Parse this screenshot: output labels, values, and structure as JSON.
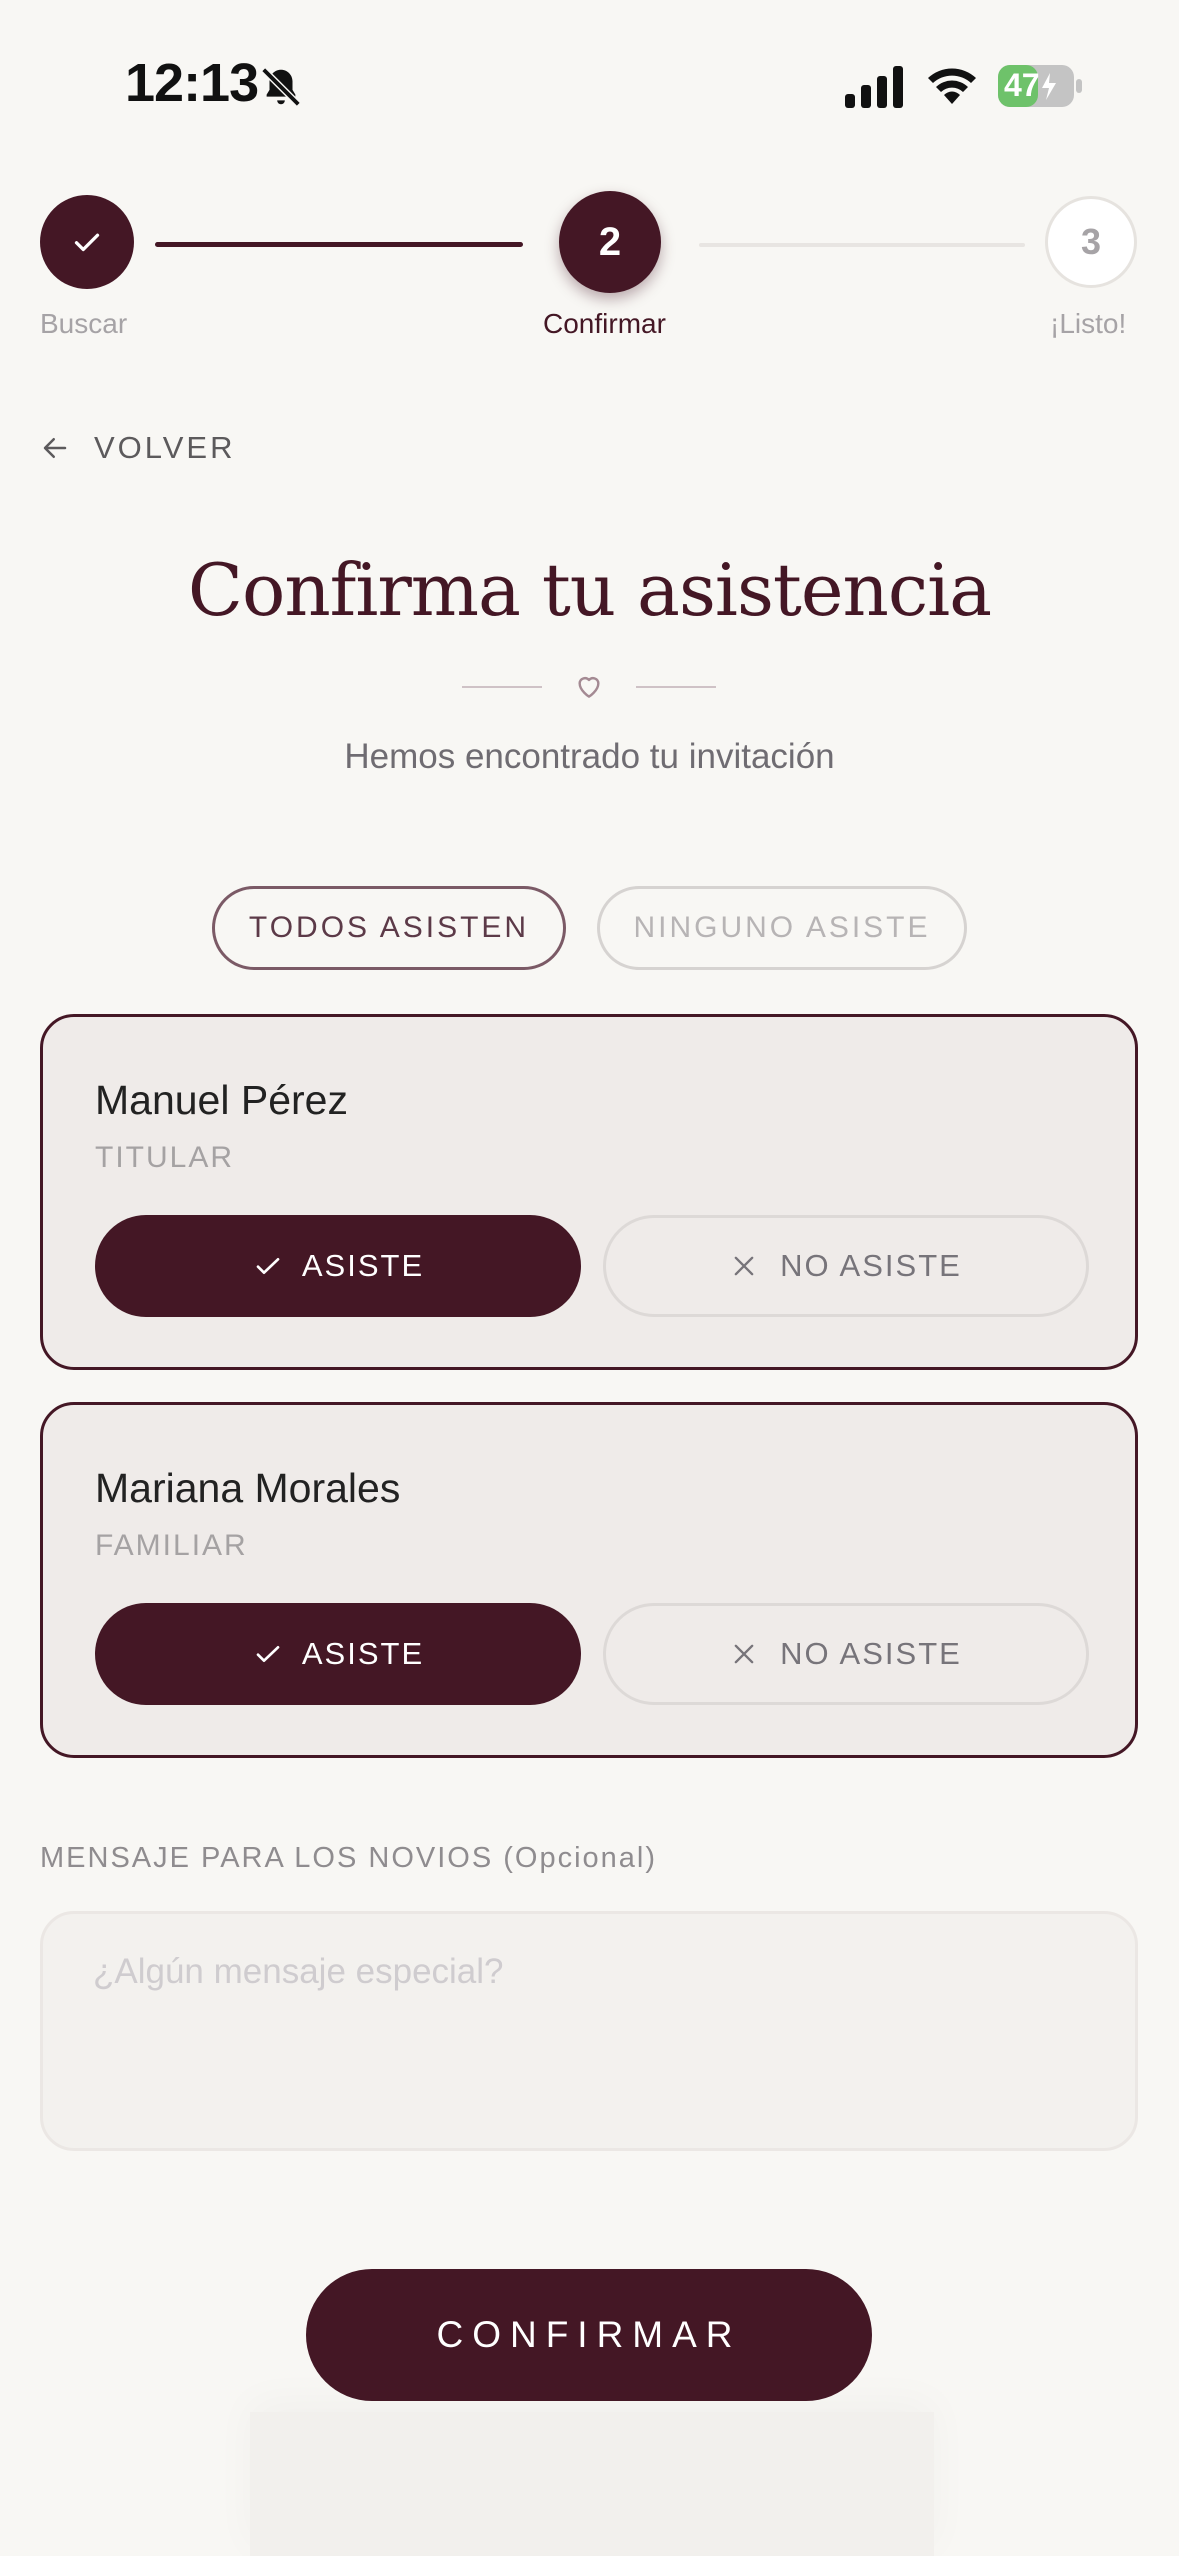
{
  "status_bar": {
    "time": "12:13",
    "battery": "47",
    "icons": [
      "bell-slash-icon",
      "signal-icon",
      "wifi-icon",
      "battery-icon"
    ]
  },
  "stepper": {
    "steps": [
      {
        "label": "Buscar",
        "number": "",
        "state": "done"
      },
      {
        "label": "Confirmar",
        "number": "2",
        "state": "active"
      },
      {
        "label": "¡Listo!",
        "number": "3",
        "state": "pending"
      }
    ]
  },
  "nav": {
    "back_label": "VOLVER"
  },
  "header": {
    "title": "Confirma tu asistencia",
    "subtitle": "Hemos encontrado tu invitación"
  },
  "bulk": {
    "all_label": "TODOS ASISTEN",
    "none_label": "NINGUNO ASISTE"
  },
  "guests": [
    {
      "name": "Manuel Pérez",
      "role": "TITULAR",
      "yes_label": "ASISTE",
      "no_label": "NO ASISTE",
      "status": "asiste"
    },
    {
      "name": "Mariana Morales",
      "role": "FAMILIAR",
      "yes_label": "ASISTE",
      "no_label": "NO ASISTE",
      "status": "asiste"
    }
  ],
  "message": {
    "label": "MENSAJE PARA LOS NOVIOS (Opcional)",
    "placeholder": "¿Algún mensaje especial?",
    "value": ""
  },
  "confirm_label": "CONFIRMAR",
  "colors": {
    "accent": "#441725",
    "background": "#f8f7f4",
    "battery": "#6ec26a"
  }
}
